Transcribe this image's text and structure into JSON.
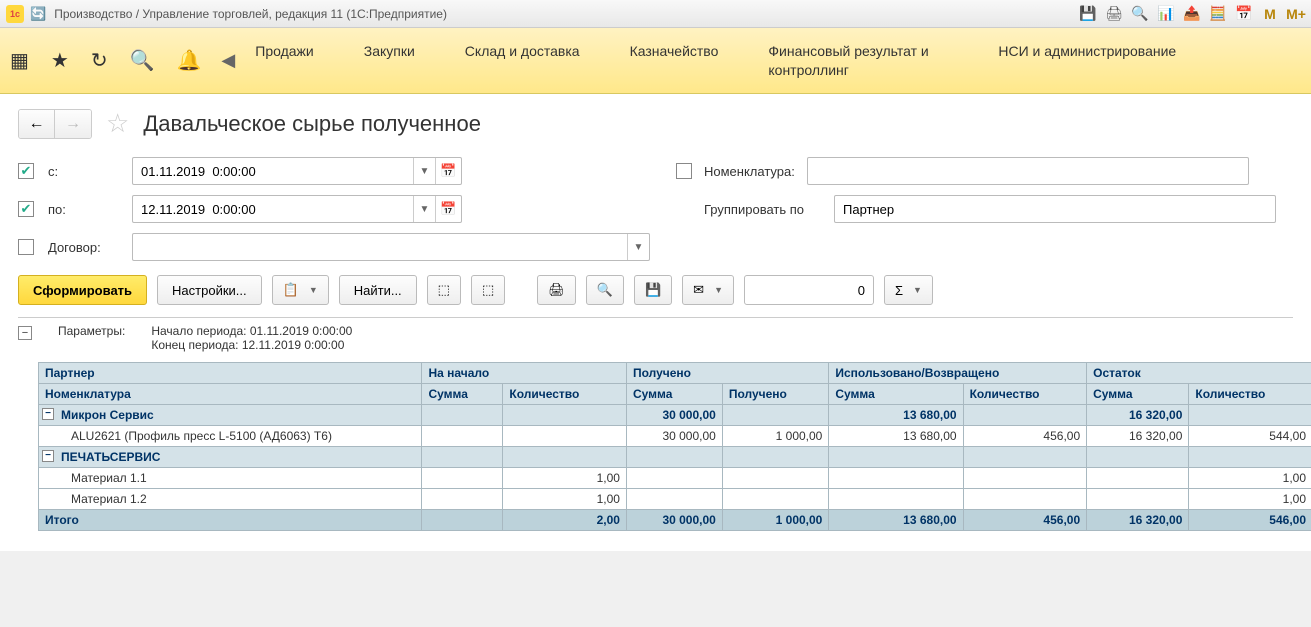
{
  "window": {
    "title": "Производство / Управление торговлей, редакция 11  (1С:Предприятие)"
  },
  "nav": {
    "items": [
      "Продажи",
      "Закупки",
      "Склад и доставка",
      "Казначейство",
      "Финансовый результат и контроллинг",
      "НСИ и администрирование"
    ]
  },
  "page": {
    "title": "Давальческое сырье полученное"
  },
  "filters": {
    "from_label": "с:",
    "from_value": "01.11.2019  0:00:00",
    "to_label": "по:",
    "to_value": "12.11.2019  0:00:00",
    "nomen_label": "Номенклатура:",
    "nomen_value": "",
    "group_label": "Группировать по",
    "group_value": "Партнер",
    "dogovor_label": "Договор:",
    "dogovor_value": ""
  },
  "toolbar": {
    "form": "Сформировать",
    "settings": "Настройки...",
    "find": "Найти...",
    "num": "0",
    "sigma": "Σ"
  },
  "params": {
    "label": "Параметры:",
    "line1_label": "Начало периода:",
    "line1_value": "01.11.2019 0:00:00",
    "line2_label": "Конец периода:",
    "line2_value": "12.11.2019 0:00:00"
  },
  "table": {
    "headers": {
      "partner": "Партнер",
      "nachalo": "На начало",
      "polucheno": "Получено",
      "ispolz": "Использовано/Возвращено",
      "ostatok": "Остаток",
      "nomen": "Номенклатура",
      "summa": "Сумма",
      "kolvo": "Количество",
      "polucheno2": "Получено"
    },
    "rows": [
      {
        "type": "group",
        "name": "Микрон Сервис",
        "pol_sum": "30 000,00",
        "isp_sum": "13 680,00",
        "ost_sum": "16 320,00"
      },
      {
        "type": "detail",
        "name": "ALU2621 (Профиль пресс L-5100 (АД6063) Т6)",
        "pol_sum": "30 000,00",
        "pol_qty": "1 000,00",
        "isp_sum": "13 680,00",
        "isp_qty": "456,00",
        "ost_sum": "16 320,00",
        "ost_qty": "544,00"
      },
      {
        "type": "group",
        "name": "ПЕЧАТЬСЕРВИС"
      },
      {
        "type": "detail",
        "name": "Материал 1.1",
        "na_qty": "1,00",
        "ost_qty": "1,00"
      },
      {
        "type": "detail",
        "name": "Материал 1.2",
        "na_qty": "1,00",
        "ost_qty": "1,00"
      },
      {
        "type": "total",
        "name": "Итого",
        "na_qty": "2,00",
        "pol_sum": "30 000,00",
        "pol_qty": "1 000,00",
        "isp_sum": "13 680,00",
        "isp_qty": "456,00",
        "ost_sum": "16 320,00",
        "ost_qty": "546,00"
      }
    ]
  }
}
